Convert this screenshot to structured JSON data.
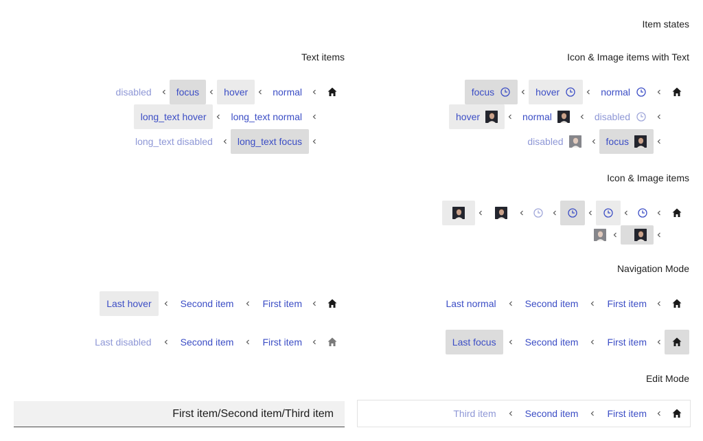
{
  "headers": {
    "item_states": "Item states",
    "text_items": "Text items",
    "icon_image_with_text": "Icon & Image items with Text",
    "icon_image_items": "Icon & Image items",
    "navigation_mode": "Navigation Mode",
    "edit_mode": "Edit Mode"
  },
  "text_items": {
    "row1": [
      "disabled",
      "focus",
      "hover",
      "normal"
    ],
    "row2": [
      "long_text hover",
      "long_text normal"
    ],
    "row3": [
      "long_text disabled",
      "long_text focus"
    ]
  },
  "icon_text_items": {
    "row1": [
      "focus",
      "hover",
      "normal"
    ],
    "row2": [
      "hover",
      "normal",
      "disabled"
    ],
    "row3": [
      "disabled",
      "focus"
    ]
  },
  "navigation": {
    "left_row1": [
      "Last hover",
      "Second item",
      "First item"
    ],
    "left_row2": [
      "Last disabled",
      "Second item",
      "First item"
    ],
    "right_row1": [
      "Last normal",
      "Second item",
      "First item"
    ],
    "right_row2": [
      "Last focus",
      "Second item",
      "First item"
    ]
  },
  "edit_mode": {
    "path_value": "First item/Second item/Third item",
    "items": [
      "Third item",
      "Second item",
      "First item"
    ]
  },
  "icons": {
    "home": "home-icon",
    "separator": "chevron-left-icon",
    "clock": "clock-icon",
    "avatar": "avatar-image"
  },
  "colors": {
    "link": "#3b4dc5",
    "link_disabled": "#8e97d6",
    "hover_bg": "#ebebeb",
    "focus_bg": "#dcdcdc"
  }
}
